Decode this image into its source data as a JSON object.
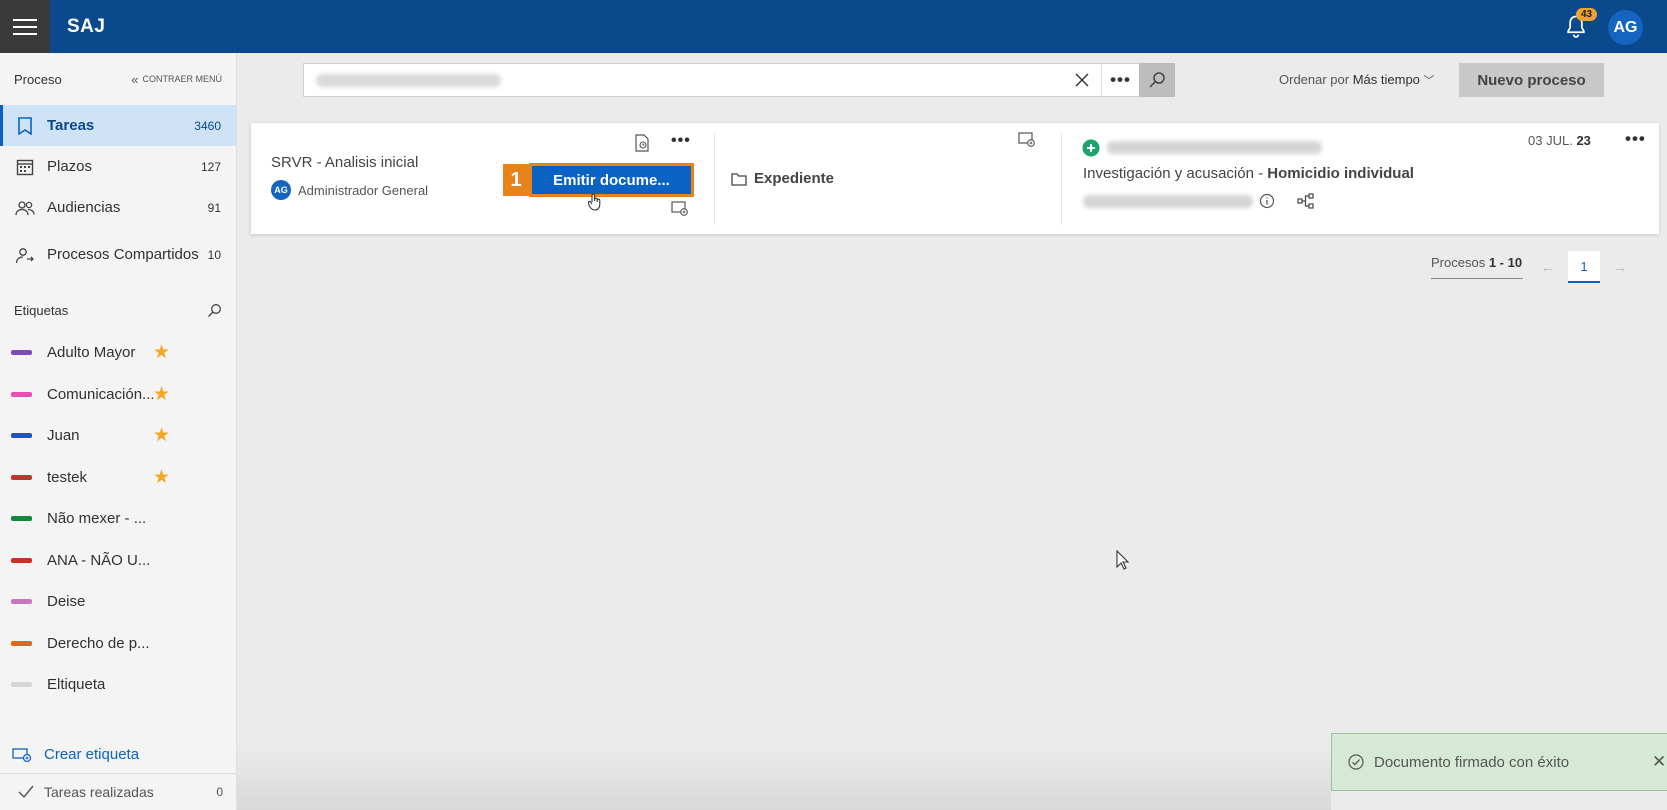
{
  "app": {
    "brand": "SAJ"
  },
  "header": {
    "notifications_count": "43",
    "user_initials": "AG"
  },
  "sidebar": {
    "title": "Proceso",
    "collapse_label": "CONTRAER MENÚ",
    "items": [
      {
        "label": "Tareas",
        "count": "3460",
        "icon": "bookmark-icon"
      },
      {
        "label": "Plazos",
        "count": "127",
        "icon": "calendar-icon"
      },
      {
        "label": "Audiencias",
        "count": "91",
        "icon": "people-icon"
      },
      {
        "label": "Procesos Compartidos",
        "count": "10",
        "icon": "shared-icon"
      }
    ],
    "tags_title": "Etiquetas",
    "tags": [
      {
        "label": "Adulto Mayor",
        "color": "#7a4cc2",
        "starred": true
      },
      {
        "label": "Comunicación...",
        "color": "#e84fb0",
        "starred": true
      },
      {
        "label": "Juan",
        "color": "#1f56b8",
        "starred": true
      },
      {
        "label": "testek",
        "color": "#c9302c",
        "starred": true
      },
      {
        "label": "Não mexer - ...",
        "color": "#12883b",
        "starred": false
      },
      {
        "label": "ANA - NÃO U...",
        "color": "#c9302c",
        "starred": false
      },
      {
        "label": "Deise",
        "color": "#c777c0",
        "starred": false
      },
      {
        "label": "Derecho de p...",
        "color": "#e8650a",
        "starred": false
      },
      {
        "label": "Eltiqueta",
        "color": "#d6d6d6",
        "starred": false
      }
    ],
    "create_tag": "Crear etiqueta",
    "done_tasks": {
      "label": "Tareas realizadas",
      "count": "0"
    }
  },
  "toolbar": {
    "sort_prefix": "Ordenar por",
    "sort_value": "Más tiempo",
    "new_process": "Nuevo proceso"
  },
  "card": {
    "title": "SRVR - Analisis inicial",
    "assignee_initials": "AG",
    "assignee": "Administrador General",
    "step": "1",
    "emit_button": "Emitir docume...",
    "expediente": "Expediente",
    "case_class": "Investigación y acusación",
    "case_subject": "Homicidio individual",
    "date_day_month": "03 JUL.",
    "date_year": "23"
  },
  "pager": {
    "label": "Procesos",
    "range": "1 - 10",
    "current_page": "1"
  },
  "toast": {
    "message": "Documento firmado con éxito"
  },
  "colors": {
    "topbar": "#0a4a8c",
    "accent": "#0a63c4",
    "highlight": "#e8821a"
  }
}
